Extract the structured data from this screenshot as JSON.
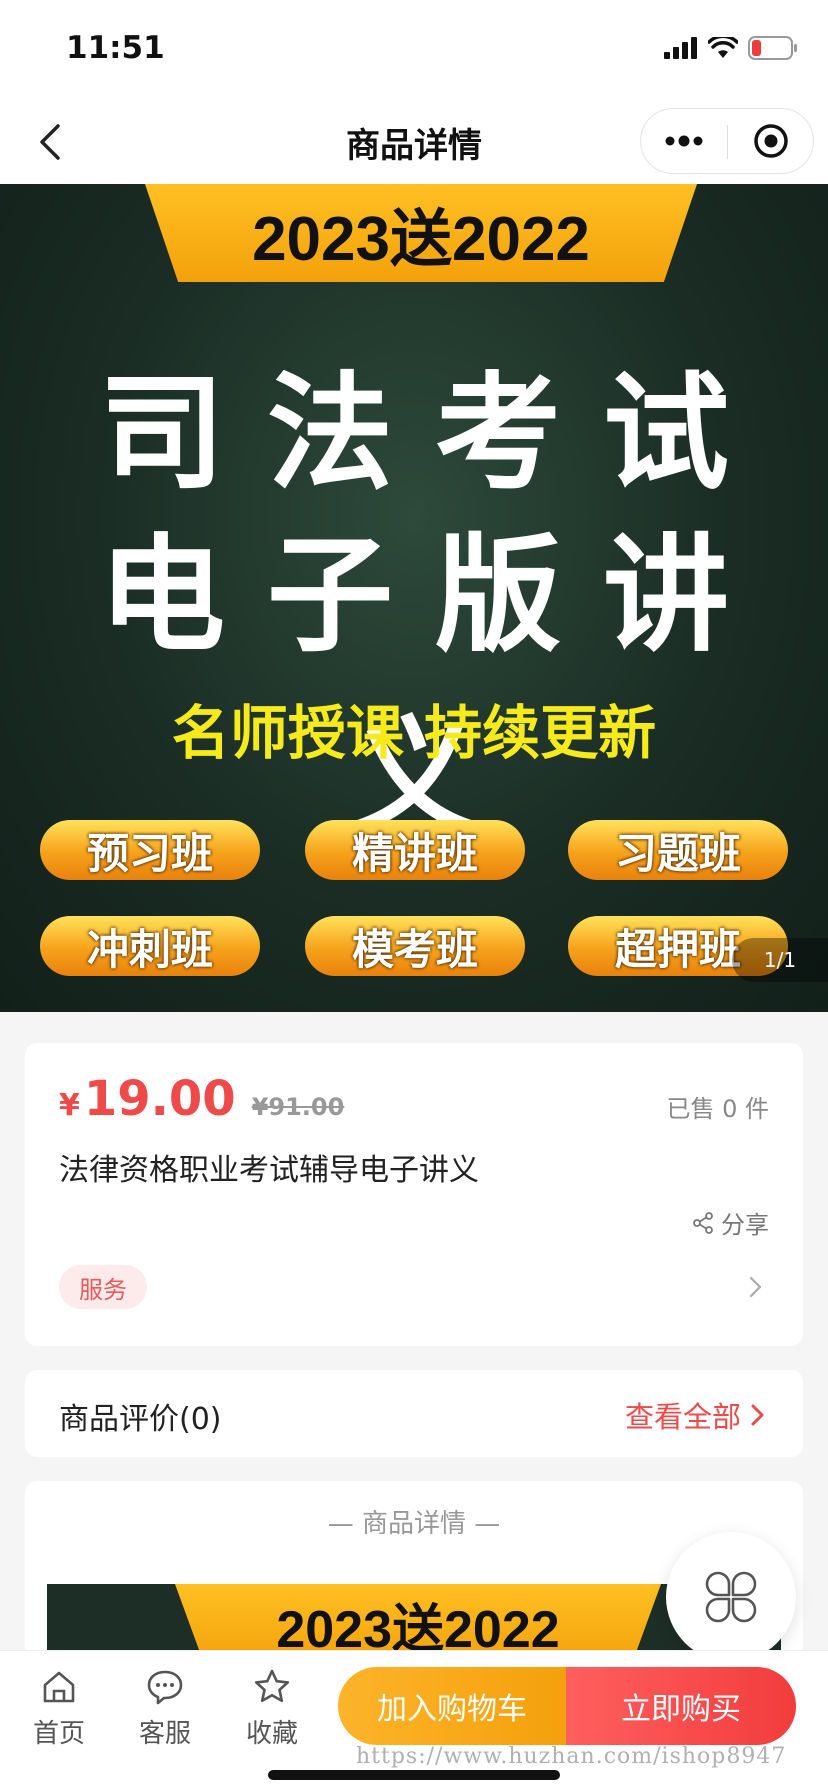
{
  "status_bar": {
    "time": "11:51"
  },
  "nav": {
    "title": "商品详情"
  },
  "banner": {
    "year_text": "2023送2022",
    "line1": "司法考试",
    "line2": "电子版讲义",
    "slogan": "名师授课 持续更新",
    "classes": [
      "预习班",
      "精讲班",
      "习题班",
      "冲刺班",
      "模考班",
      "超押班"
    ],
    "counter": "1/1"
  },
  "product": {
    "price_symbol": "¥",
    "price": "19.00",
    "original_price": "¥91.00",
    "sold": "已售 0 件",
    "title": "法律资格职业考试辅导电子讲义",
    "share_label": "分享",
    "service_label": "服务"
  },
  "reviews": {
    "label": "商品评价(0)",
    "view_all": "查看全部"
  },
  "detail": {
    "heading": "— 商品详情 —",
    "image_year_text": "2023送2022"
  },
  "bottom_bar": {
    "tabs": [
      {
        "label": "首页",
        "icon": "home-icon"
      },
      {
        "label": "客服",
        "icon": "chat-icon"
      },
      {
        "label": "收藏",
        "icon": "star-icon"
      }
    ],
    "add_to_cart": "加入购物车",
    "buy_now": "立即购买"
  },
  "watermark": "https://www.huzhan.com/ishop8947",
  "colors": {
    "accent_red": "#ee4a4a",
    "accent_orange": "#f4a00c",
    "banner_yellow": "#f6ea1a"
  }
}
